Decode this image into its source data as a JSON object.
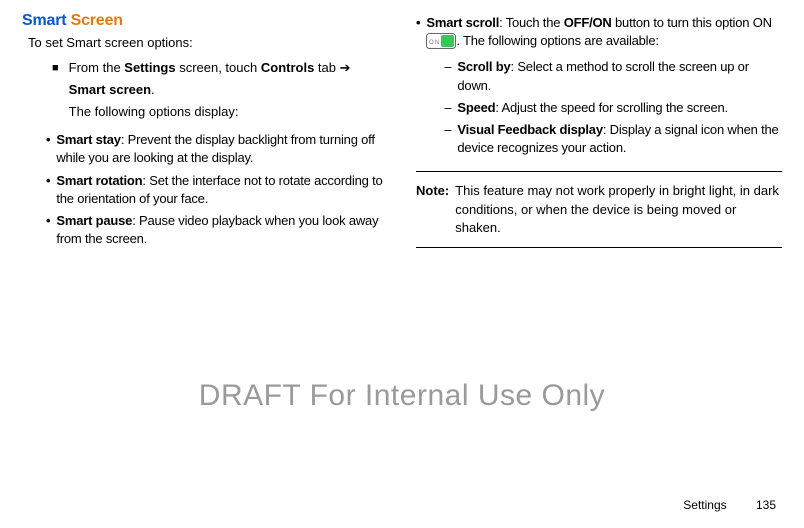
{
  "head": {
    "w1": "Smart",
    "w2": "Screen"
  },
  "intro": "To set Smart screen options:",
  "step": {
    "l1a": "From the ",
    "l1b": "Settings",
    "l1c": " screen, touch ",
    "l1d": "Controls",
    "l1e": " tab ➔",
    "l2": "Smart screen",
    "l2end": ".",
    "l3": "The following options display:"
  },
  "left": [
    {
      "b": "Smart stay",
      "t": ": Prevent the display backlight from turning off while you are looking at the display."
    },
    {
      "b": "Smart rotation",
      "t": ": Set the interface not to rotate according to the orientation of your face."
    },
    {
      "b": "Smart pause",
      "t": ": Pause video playback when you look away from the screen."
    }
  ],
  "scroll": {
    "b": "Smart scroll",
    "t1": ": Touch the ",
    "btn": "OFF/ON",
    "t2": " button to turn this option ON ",
    "t3": ". The following options are available:",
    "subs": [
      {
        "b": "Scroll by",
        "t": ": Select a method to scroll the screen up or down."
      },
      {
        "b": "Speed",
        "t": ": Adjust the speed for scrolling the screen."
      },
      {
        "b": "Visual Feedback display",
        "t": ": Display a signal icon when the device recognizes your action."
      }
    ]
  },
  "note": {
    "lbl": "Note:",
    "body": "This feature may not work properly in bright light, in dark conditions, or when the device is being moved or shaken."
  },
  "watermark": "DRAFT For Internal Use Only",
  "footer": {
    "section": "Settings",
    "page": "135"
  }
}
